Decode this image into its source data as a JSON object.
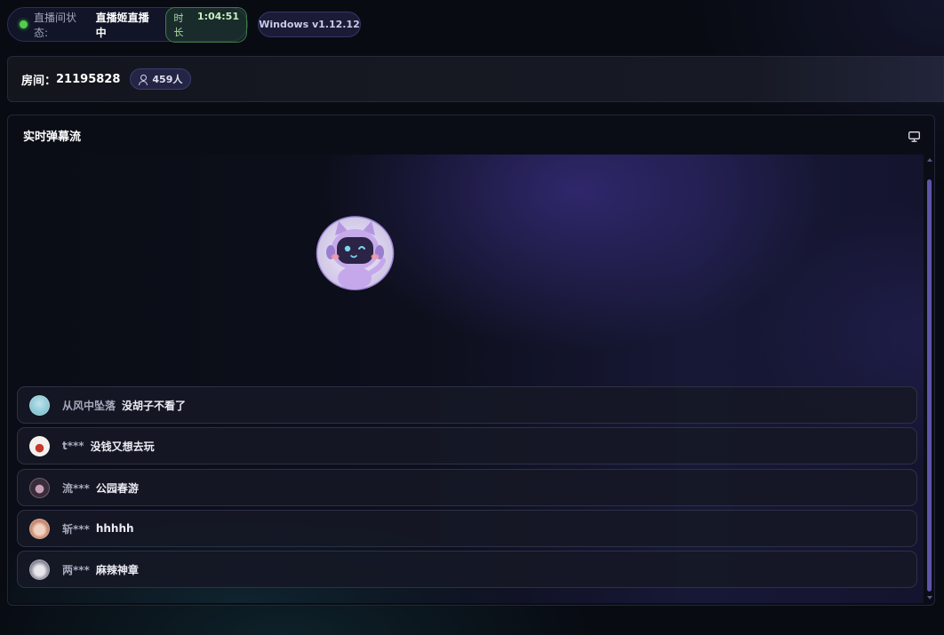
{
  "status": {
    "label": "直播间状态:",
    "value": "直播姬直播中",
    "duration_label": "时长",
    "duration_value": "1:04:51"
  },
  "version": "Windows v1.12.12",
  "room": {
    "label": "房间：",
    "id": "21195828",
    "viewers": "459人"
  },
  "panel": {
    "title": "实时弹幕流"
  },
  "danmaku": [
    {
      "user": "从风中坠落",
      "message": "没胡子不看了",
      "avatar_colors": [
        "#bfe4ee",
        "#6fb8c8"
      ]
    },
    {
      "user": "t***",
      "message": "没钱又想去玩",
      "avatar_colors": [
        "#f4f0ee",
        "#c23a2c"
      ]
    },
    {
      "user": "流***",
      "message": "公园春游",
      "avatar_colors": [
        "#3a2c3a",
        "#c8a0b8"
      ]
    },
    {
      "user": "斩***",
      "message": "hhhhh",
      "avatar_colors": [
        "#f0d2c2",
        "#c88a70"
      ]
    },
    {
      "user": "两***",
      "message": "麻辣神章",
      "avatar_colors": [
        "#e8e6ec",
        "#8a8898"
      ]
    }
  ],
  "colors": {
    "live_dot": "#4fd14a",
    "accent": "#5d56a8"
  },
  "icons": [
    "live-status-dot",
    "user-icon",
    "monitor-icon",
    "mascot-avatar"
  ]
}
